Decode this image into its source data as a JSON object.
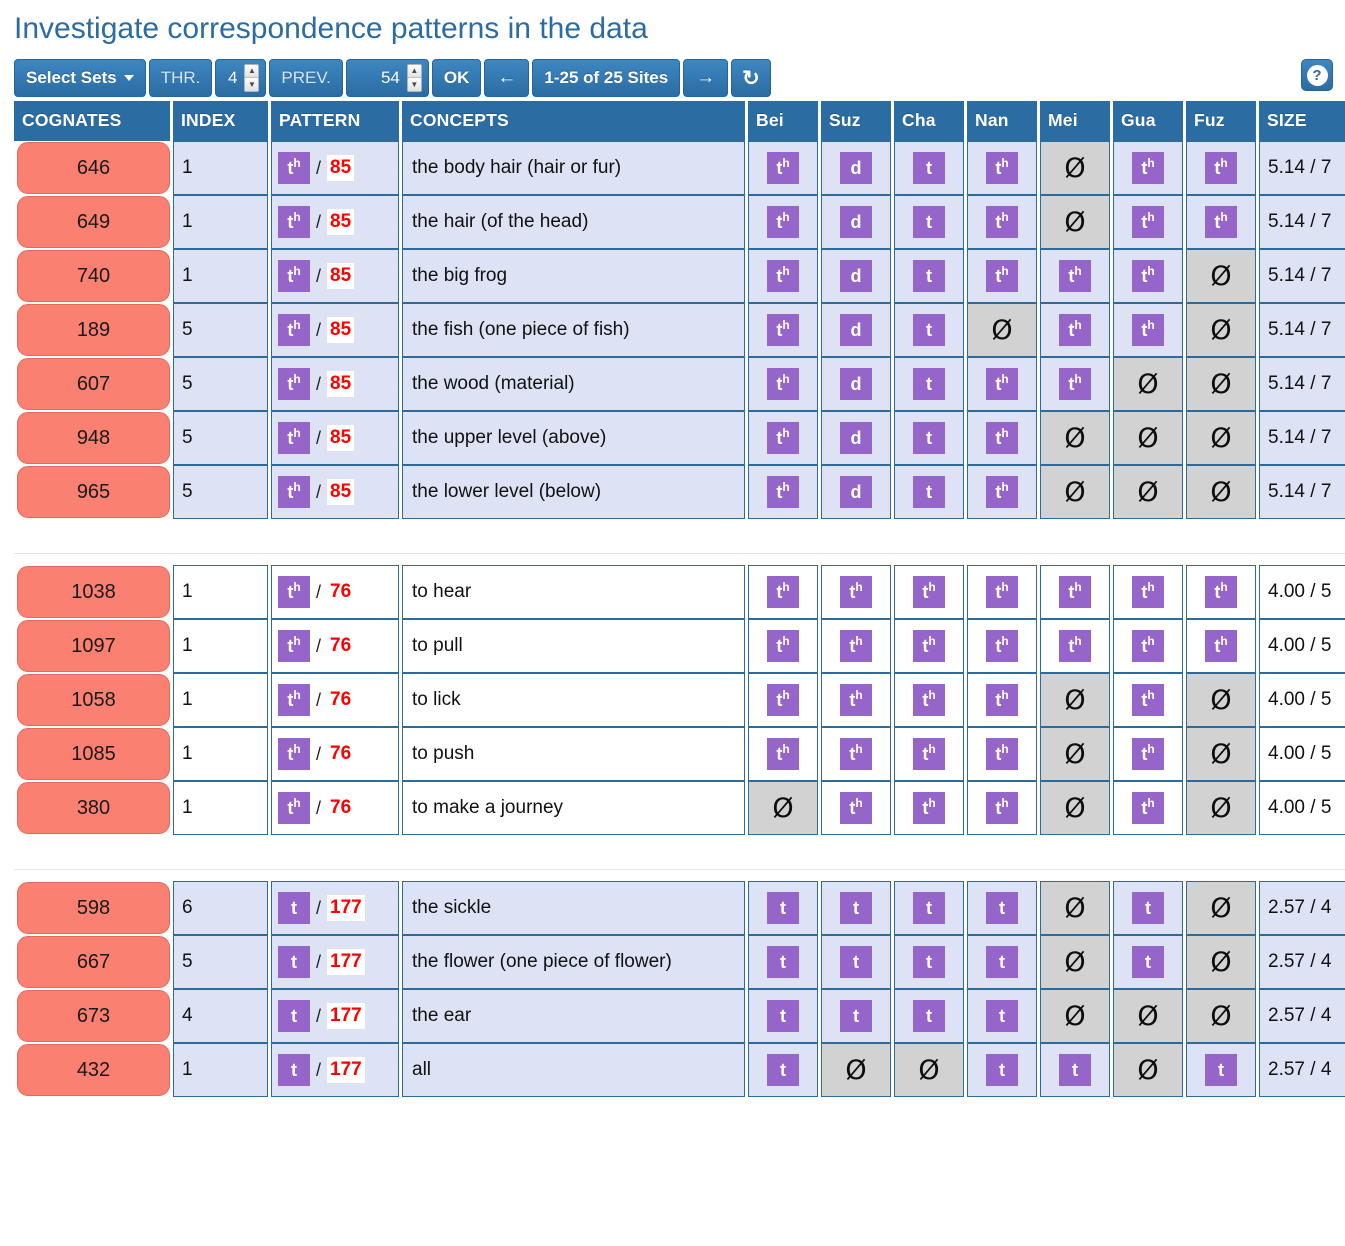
{
  "header": {
    "title": "Investigate correspondence patterns in the data"
  },
  "toolbar": {
    "select_sets_label": "Select Sets",
    "thr_label": "THR.",
    "thr_value": "4",
    "prev_label": "PREV.",
    "prev_value": "54",
    "ok_label": "OK",
    "prev_page_icon": "←",
    "pagination_label": "1-25 of 25 Sites",
    "next_page_icon": "→",
    "refresh_icon": "↻",
    "help_label": "?",
    "spin_up": "▲",
    "spin_down": "▼"
  },
  "table": {
    "columns": {
      "cognates": "COGNATES",
      "index": "INDEX",
      "pattern": "PATTERN",
      "concepts": "CONCEPTS",
      "size": "SIZE"
    },
    "sites": [
      "Bei",
      "Suz",
      "Cha",
      "Nan",
      "Mei",
      "Gua",
      "Fuz"
    ],
    "null_symbol": "Ø",
    "slash": "/",
    "blocks": [
      {
        "tint": true,
        "rows": [
          {
            "cognate": "646",
            "index": "1",
            "pattern_base": "t",
            "pattern_sup": "h",
            "pattern_num": "85",
            "concept": "the body hair (hair or fur)",
            "size": "5.14 / 7",
            "reflexes": [
              {
                "base": "t",
                "sup": "h"
              },
              {
                "base": "d",
                "sup": ""
              },
              {
                "base": "t",
                "sup": ""
              },
              {
                "base": "t",
                "sup": "h"
              },
              null,
              {
                "base": "t",
                "sup": "h"
              },
              {
                "base": "t",
                "sup": "h"
              }
            ]
          },
          {
            "cognate": "649",
            "index": "1",
            "pattern_base": "t",
            "pattern_sup": "h",
            "pattern_num": "85",
            "concept": "the hair (of the head)",
            "size": "5.14 / 7",
            "reflexes": [
              {
                "base": "t",
                "sup": "h"
              },
              {
                "base": "d",
                "sup": ""
              },
              {
                "base": "t",
                "sup": ""
              },
              {
                "base": "t",
                "sup": "h"
              },
              null,
              {
                "base": "t",
                "sup": "h"
              },
              {
                "base": "t",
                "sup": "h"
              }
            ]
          },
          {
            "cognate": "740",
            "index": "1",
            "pattern_base": "t",
            "pattern_sup": "h",
            "pattern_num": "85",
            "concept": "the big frog",
            "size": "5.14 / 7",
            "reflexes": [
              {
                "base": "t",
                "sup": "h"
              },
              {
                "base": "d",
                "sup": ""
              },
              {
                "base": "t",
                "sup": ""
              },
              {
                "base": "t",
                "sup": "h"
              },
              {
                "base": "t",
                "sup": "h"
              },
              {
                "base": "t",
                "sup": "h"
              },
              null
            ]
          },
          {
            "cognate": "189",
            "index": "5",
            "pattern_base": "t",
            "pattern_sup": "h",
            "pattern_num": "85",
            "concept": "the fish (one piece of fish)",
            "size": "5.14 / 7",
            "reflexes": [
              {
                "base": "t",
                "sup": "h"
              },
              {
                "base": "d",
                "sup": ""
              },
              {
                "base": "t",
                "sup": ""
              },
              null,
              {
                "base": "t",
                "sup": "h"
              },
              {
                "base": "t",
                "sup": "h"
              },
              null
            ]
          },
          {
            "cognate": "607",
            "index": "5",
            "pattern_base": "t",
            "pattern_sup": "h",
            "pattern_num": "85",
            "concept": "the wood (material)",
            "size": "5.14 / 7",
            "reflexes": [
              {
                "base": "t",
                "sup": "h"
              },
              {
                "base": "d",
                "sup": ""
              },
              {
                "base": "t",
                "sup": ""
              },
              {
                "base": "t",
                "sup": "h"
              },
              {
                "base": "t",
                "sup": "h"
              },
              null,
              null
            ]
          },
          {
            "cognate": "948",
            "index": "5",
            "pattern_base": "t",
            "pattern_sup": "h",
            "pattern_num": "85",
            "concept": "the upper level (above)",
            "size": "5.14 / 7",
            "reflexes": [
              {
                "base": "t",
                "sup": "h"
              },
              {
                "base": "d",
                "sup": ""
              },
              {
                "base": "t",
                "sup": ""
              },
              {
                "base": "t",
                "sup": "h"
              },
              null,
              null,
              null
            ]
          },
          {
            "cognate": "965",
            "index": "5",
            "pattern_base": "t",
            "pattern_sup": "h",
            "pattern_num": "85",
            "concept": "the lower level (below)",
            "size": "5.14 / 7",
            "reflexes": [
              {
                "base": "t",
                "sup": "h"
              },
              {
                "base": "d",
                "sup": ""
              },
              {
                "base": "t",
                "sup": ""
              },
              {
                "base": "t",
                "sup": "h"
              },
              null,
              null,
              null
            ]
          }
        ]
      },
      {
        "tint": false,
        "rows": [
          {
            "cognate": "1038",
            "index": "1",
            "pattern_base": "t",
            "pattern_sup": "h",
            "pattern_num": "76",
            "concept": "to hear",
            "size": "4.00 / 5",
            "reflexes": [
              {
                "base": "t",
                "sup": "h"
              },
              {
                "base": "t",
                "sup": "h"
              },
              {
                "base": "t",
                "sup": "h"
              },
              {
                "base": "t",
                "sup": "h"
              },
              {
                "base": "t",
                "sup": "h"
              },
              {
                "base": "t",
                "sup": "h"
              },
              {
                "base": "t",
                "sup": "h"
              }
            ]
          },
          {
            "cognate": "1097",
            "index": "1",
            "pattern_base": "t",
            "pattern_sup": "h",
            "pattern_num": "76",
            "concept": "to pull",
            "size": "4.00 / 5",
            "reflexes": [
              {
                "base": "t",
                "sup": "h"
              },
              {
                "base": "t",
                "sup": "h"
              },
              {
                "base": "t",
                "sup": "h"
              },
              {
                "base": "t",
                "sup": "h"
              },
              {
                "base": "t",
                "sup": "h"
              },
              {
                "base": "t",
                "sup": "h"
              },
              {
                "base": "t",
                "sup": "h"
              }
            ]
          },
          {
            "cognate": "1058",
            "index": "1",
            "pattern_base": "t",
            "pattern_sup": "h",
            "pattern_num": "76",
            "concept": "to lick",
            "size": "4.00 / 5",
            "reflexes": [
              {
                "base": "t",
                "sup": "h"
              },
              {
                "base": "t",
                "sup": "h"
              },
              {
                "base": "t",
                "sup": "h"
              },
              {
                "base": "t",
                "sup": "h"
              },
              null,
              {
                "base": "t",
                "sup": "h"
              },
              null
            ]
          },
          {
            "cognate": "1085",
            "index": "1",
            "pattern_base": "t",
            "pattern_sup": "h",
            "pattern_num": "76",
            "concept": "to push",
            "size": "4.00 / 5",
            "reflexes": [
              {
                "base": "t",
                "sup": "h"
              },
              {
                "base": "t",
                "sup": "h"
              },
              {
                "base": "t",
                "sup": "h"
              },
              {
                "base": "t",
                "sup": "h"
              },
              null,
              {
                "base": "t",
                "sup": "h"
              },
              null
            ]
          },
          {
            "cognate": "380",
            "index": "1",
            "pattern_base": "t",
            "pattern_sup": "h",
            "pattern_num": "76",
            "concept": "to make a journey",
            "size": "4.00 / 5",
            "reflexes": [
              null,
              {
                "base": "t",
                "sup": "h"
              },
              {
                "base": "t",
                "sup": "h"
              },
              {
                "base": "t",
                "sup": "h"
              },
              null,
              {
                "base": "t",
                "sup": "h"
              },
              null
            ]
          }
        ]
      },
      {
        "tint": true,
        "rows": [
          {
            "cognate": "598",
            "index": "6",
            "pattern_base": "t",
            "pattern_sup": "",
            "pattern_num": "177",
            "concept": "the sickle",
            "size": "2.57 / 4",
            "reflexes": [
              {
                "base": "t",
                "sup": ""
              },
              {
                "base": "t",
                "sup": ""
              },
              {
                "base": "t",
                "sup": ""
              },
              {
                "base": "t",
                "sup": ""
              },
              null,
              {
                "base": "t",
                "sup": ""
              },
              null
            ]
          },
          {
            "cognate": "667",
            "index": "5",
            "pattern_base": "t",
            "pattern_sup": "",
            "pattern_num": "177",
            "concept": "the flower (one piece of flower)",
            "size": "2.57 / 4",
            "reflexes": [
              {
                "base": "t",
                "sup": ""
              },
              {
                "base": "t",
                "sup": ""
              },
              {
                "base": "t",
                "sup": ""
              },
              {
                "base": "t",
                "sup": ""
              },
              null,
              {
                "base": "t",
                "sup": ""
              },
              null
            ]
          },
          {
            "cognate": "673",
            "index": "4",
            "pattern_base": "t",
            "pattern_sup": "",
            "pattern_num": "177",
            "concept": "the ear",
            "size": "2.57 / 4",
            "reflexes": [
              {
                "base": "t",
                "sup": ""
              },
              {
                "base": "t",
                "sup": ""
              },
              {
                "base": "t",
                "sup": ""
              },
              {
                "base": "t",
                "sup": ""
              },
              null,
              null,
              null
            ]
          },
          {
            "cognate": "432",
            "index": "1",
            "pattern_base": "t",
            "pattern_sup": "",
            "pattern_num": "177",
            "concept": "all",
            "size": "2.57 / 4",
            "reflexes": [
              {
                "base": "t",
                "sup": ""
              },
              null,
              null,
              {
                "base": "t",
                "sup": ""
              },
              {
                "base": "t",
                "sup": ""
              },
              null,
              {
                "base": "t",
                "sup": ""
              }
            ]
          }
        ]
      }
    ]
  },
  "colors": {
    "brand_blue": "#2b6ca3",
    "cognate_salmon": "#fa8072",
    "badge_purple": "#9565c9",
    "row_tint": "#dde3f5",
    "empty_gray": "#d2d2d2",
    "pattern_red": "#ff0000"
  }
}
